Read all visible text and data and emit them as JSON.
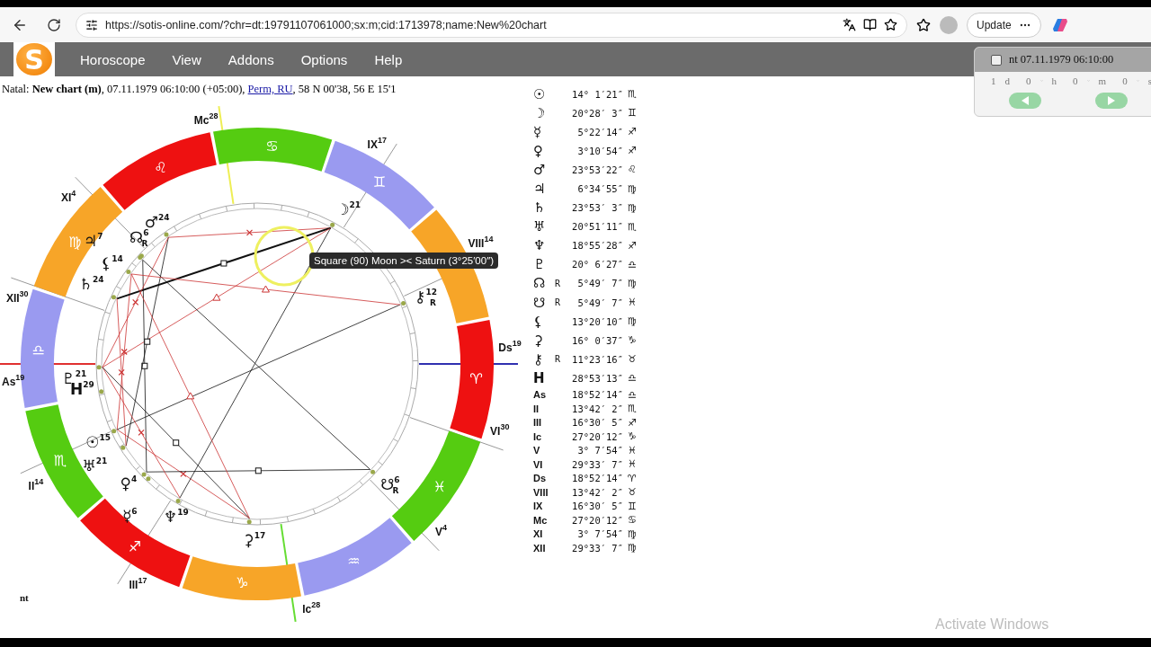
{
  "browser": {
    "url": "https://sotis-online.com/?chr=dt:19791107061000;sx:m;cid:1713978;name:New%20chart",
    "update_button": "Update"
  },
  "menu": {
    "logo": "S",
    "items": [
      "Horoscope",
      "View",
      "Addons",
      "Options",
      "Help"
    ]
  },
  "chart_info": {
    "text": "Natal: **New chart (m)**, 07.11.1979 06:10:00 (+05:00), ",
    "place": "Perm, RU",
    "coords": ", 58 N 00'38, 56 E 15'1"
  },
  "wheel": {
    "signs": [
      {
        "glyph": "♈",
        "color": "#ee1111"
      },
      {
        "color": "#f7a528"
      },
      {
        "glyph": "♊",
        "color": "#9a9af0"
      },
      {
        "glyph": "♋",
        "color": "#55cc11"
      },
      {
        "glyph": "♌",
        "color": "#ee1111"
      },
      {
        "glyph": "♍",
        "color": "#f7a528"
      },
      {
        "glyph": "♎",
        "color": "#9a9af0"
      },
      {
        "glyph": "♏",
        "color": "#55cc11"
      },
      {
        "glyph": "♐",
        "color": "#ee1111"
      },
      {
        "glyph": "♑",
        "color": "#f7a528"
      },
      {
        "glyph": "♒",
        "color": "#9a9af0"
      },
      {
        "glyph": "♓",
        "color": "#55cc11"
      }
    ],
    "houses": [
      {
        "label": "As",
        "degree": "19"
      },
      {
        "label": "II",
        "degree": "14"
      },
      {
        "label": "III",
        "degree": "17"
      },
      {
        "label": "Ic",
        "degree": "28"
      },
      {
        "label": "V",
        "degree": "4"
      },
      {
        "label": "VI",
        "degree": "30"
      },
      {
        "label": "Ds",
        "degree": "19"
      },
      {
        "label": "VIII",
        "degree": "14"
      },
      {
        "label": "IX",
        "degree": "17"
      },
      {
        "label": "Mc",
        "degree": "28"
      },
      {
        "label": "XI",
        "degree": "4"
      },
      {
        "label": "XII",
        "degree": "30"
      }
    ],
    "planets": [
      {
        "glyph": "☉",
        "degree": "15"
      },
      {
        "glyph": "☽",
        "degree": "21"
      },
      {
        "glyph": "♀",
        "degree": "4"
      },
      {
        "glyph": "☿",
        "degree": "6"
      },
      {
        "glyph": "♂",
        "degree": "24"
      },
      {
        "glyph": "♃",
        "degree": "7"
      },
      {
        "glyph": "♄",
        "degree": "24"
      },
      {
        "glyph": "♅",
        "degree": "21"
      },
      {
        "glyph": "♆",
        "degree": "19"
      },
      {
        "glyph": "♇",
        "degree": "21"
      },
      {
        "glyph": "☊",
        "degree": "6",
        "flag": "R"
      },
      {
        "glyph": "☋",
        "degree": "6",
        "flag": "R"
      },
      {
        "glyph": "⚸",
        "degree": "14"
      },
      {
        "glyph": "⚳",
        "degree": "17"
      },
      {
        "glyph": "⚷",
        "degree": "12",
        "flag": "R"
      },
      {
        "glyph": "H",
        "degree": "29"
      }
    ],
    "tooltip": "Square (90) Moon >< Saturn (3°25′00″)",
    "corner_note": "nt"
  },
  "positions": [
    {
      "kind": "body",
      "glyph": "☉",
      "value": "14° 1′21″",
      "sign": "♏"
    },
    {
      "kind": "body",
      "glyph": "☽",
      "value": "20°28′ 3″",
      "sign": "♊"
    },
    {
      "kind": "body",
      "glyph": "☿",
      "value": "5°22′14″",
      "sign": "♐"
    },
    {
      "kind": "body",
      "glyph": "♀",
      "value": "3°10′54″",
      "sign": "♐"
    },
    {
      "kind": "body",
      "glyph": "♂",
      "value": "23°53′22″",
      "sign": "♌"
    },
    {
      "kind": "body",
      "glyph": "♃",
      "value": "6°34′55″",
      "sign": "♍"
    },
    {
      "kind": "body",
      "glyph": "♄",
      "value": "23°53′ 3″",
      "sign": "♍"
    },
    {
      "kind": "body",
      "glyph": "♅",
      "value": "20°51′11″",
      "sign": "♏"
    },
    {
      "kind": "body",
      "glyph": "♆",
      "value": "18°55′28″",
      "sign": "♐"
    },
    {
      "kind": "body",
      "glyph": "♇",
      "value": "20° 6′27″",
      "sign": "♎"
    },
    {
      "kind": "body",
      "glyph": "☊",
      "flag": "R",
      "value": "5°49′ 7″",
      "sign": "♍"
    },
    {
      "kind": "body",
      "glyph": "☋",
      "flag": "R",
      "value": "5°49′ 7″",
      "sign": "♓"
    },
    {
      "kind": "body",
      "glyph": "⚸",
      "value": "13°20′10″",
      "sign": "♍"
    },
    {
      "kind": "body",
      "glyph": "⚳",
      "value": "16° 0′37″",
      "sign": "♑"
    },
    {
      "kind": "body",
      "glyph": "⚷",
      "flag": "R",
      "value": "11°23′16″",
      "sign": "♉"
    },
    {
      "kind": "body",
      "glyph": "H",
      "value": "28°53′13″",
      "sign": "♎"
    },
    {
      "kind": "cusp",
      "glyph": "As",
      "value": "18°52′14″",
      "sign": "♎"
    },
    {
      "kind": "cusp",
      "glyph": "II",
      "value": "13°42′ 2″",
      "sign": "♏"
    },
    {
      "kind": "cusp",
      "glyph": "III",
      "value": "16°30′ 5″",
      "sign": "♐"
    },
    {
      "kind": "cusp",
      "glyph": "Ic",
      "value": "27°20′12″",
      "sign": "♑"
    },
    {
      "kind": "cusp",
      "glyph": "V",
      "value": "3° 7′54″",
      "sign": "♓"
    },
    {
      "kind": "cusp",
      "glyph": "VI",
      "value": "29°33′ 7″",
      "sign": "♓"
    },
    {
      "kind": "cusp",
      "glyph": "Ds",
      "value": "18°52′14″",
      "sign": "♈"
    },
    {
      "kind": "cusp",
      "glyph": "VIII",
      "value": "13°42′ 2″",
      "sign": "♉"
    },
    {
      "kind": "cusp",
      "glyph": "IX",
      "value": "16°30′ 5″",
      "sign": "♊"
    },
    {
      "kind": "cusp",
      "glyph": "Mc",
      "value": "27°20′12″",
      "sign": "♋"
    },
    {
      "kind": "cusp",
      "glyph": "XI",
      "value": "3° 7′54″",
      "sign": "♍"
    },
    {
      "kind": "cusp",
      "glyph": "XII",
      "value": "29°33′ 7″",
      "sign": "♍"
    }
  ],
  "time_panel": {
    "checked": false,
    "label": "nt 07.11.1979 06:10:00",
    "steps": [
      {
        "value": "1",
        "dropdown": false,
        "unit": "d"
      },
      {
        "value": "0",
        "dropdown": true,
        "unit": "h"
      },
      {
        "value": "0",
        "dropdown": true,
        "unit": "m"
      },
      {
        "value": "0",
        "dropdown": true,
        "unit": "s"
      }
    ]
  },
  "os_notice": "Activate Windows"
}
